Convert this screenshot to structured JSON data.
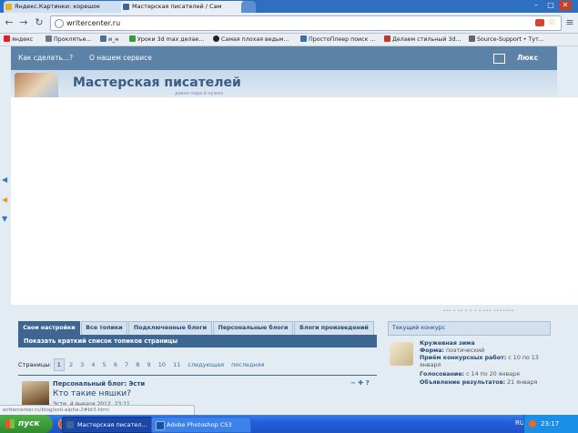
{
  "browser": {
    "tabs": [
      {
        "label": "Яндекс.Картинки: корешок",
        "color": "#e6b120"
      },
      {
        "label": "Мастерская писателей / Сам",
        "color": "#3d6790"
      }
    ],
    "window_controls": [
      "–",
      "□",
      "✕"
    ],
    "address": "writercenter.ru"
  },
  "bookmarks": [
    {
      "label": "яндекс",
      "color": "#d22"
    },
    {
      "label": "Проклятье...",
      "color": "#6a7a8c"
    },
    {
      "label": "и_н",
      "color": "#4f6f95"
    },
    {
      "label": "Уроки 3d max делае...",
      "color": "#3a9a3a"
    },
    {
      "label": "Самая плохая ведьм...",
      "color": "#222"
    },
    {
      "label": "ПростоПлеер поиск ...",
      "color": "#3a6fb0"
    },
    {
      "label": "Делаем стильный 3d...",
      "color": "#c03a2a"
    },
    {
      "label": "Source-Support • Тут...",
      "color": "#666"
    }
  ],
  "site": {
    "nav": {
      "how_to": "Как сделать...?",
      "about": "О нашем сервисе",
      "user": "Люкс Даня"
    },
    "title": "Мастерская писателей",
    "subtitle": "давно пора и нужно"
  },
  "tabs": [
    "Свои настройки",
    "Все топики",
    "Подключенные блоги",
    "Персональные блоги",
    "Блоги произведений"
  ],
  "subbar": "Показать краткий список топиков страницы",
  "pager": {
    "label": "Страницы:",
    "pages": [
      "1",
      "2",
      "3",
      "4",
      "5",
      "6",
      "7",
      "8",
      "9",
      "10",
      "11"
    ],
    "next": "следующая",
    "last": "последняя"
  },
  "post": {
    "blog": "Персональный блог: Эсти",
    "title": "Кто такие няшки?",
    "meta": "Эсти, 4 января 2012, 23:11",
    "controls": "− ✚ ?"
  },
  "status_url": "writercenter.ru/blog/esti-alpha-2#bt3.html",
  "contest": {
    "header": "Текущий конкурс",
    "name": "Кружевная зима",
    "rows": [
      {
        "label": "Форма:",
        "value": "поэтический"
      },
      {
        "label": "Приём конкурсных работ:",
        "value": "с 10 по 13"
      },
      {
        "label": "",
        "value": "января"
      },
      {
        "label": "Голосование:",
        "value": "с 14 по 20 января"
      },
      {
        "label": "Объявление результатов:",
        "value": "21 января"
      }
    ],
    "partial_text": "••• • •• • • • • ••• •••••••"
  },
  "taskbar": {
    "start": "пуск",
    "tasks": [
      {
        "label": "Мастерская писател...",
        "color": "#3d6790",
        "active": true
      },
      {
        "label": "Adobe Photoshop CS3",
        "color": "#1b4fa0",
        "active": false
      }
    ],
    "lang": "RU",
    "time": "23:17"
  }
}
